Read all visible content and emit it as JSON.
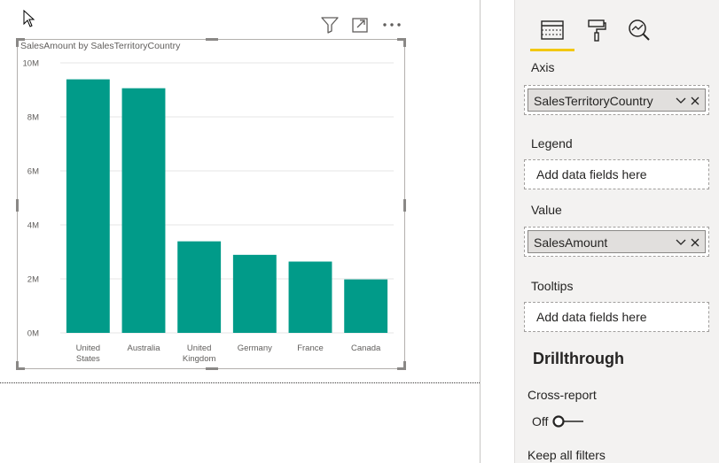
{
  "visual_header": {
    "filter_icon": "filter-icon",
    "focus_icon": "focus-mode-icon",
    "more_icon": "more-options-icon"
  },
  "chart_data": {
    "type": "bar",
    "title": "SalesAmount by SalesTerritoryCountry",
    "categories": [
      "United States",
      "Australia",
      "United Kingdom",
      "Germany",
      "France",
      "Canada"
    ],
    "category_lines": [
      [
        "United",
        "States"
      ],
      [
        "Australia"
      ],
      [
        "United",
        "Kingdom"
      ],
      [
        "Germany"
      ],
      [
        "France"
      ],
      [
        "Canada"
      ]
    ],
    "values": [
      9390000,
      9060000,
      3390000,
      2890000,
      2640000,
      1980000
    ],
    "y_ticks": [
      0,
      2000000,
      4000000,
      6000000,
      8000000,
      10000000
    ],
    "y_tick_labels": [
      "0M",
      "2M",
      "4M",
      "6M",
      "8M",
      "10M"
    ],
    "ylim": [
      0,
      10000000
    ],
    "grid": true,
    "bar_color": "#019b89"
  },
  "pane": {
    "tabs": [
      {
        "name": "fields-icon",
        "active": true
      },
      {
        "name": "format-paint-roller-icon",
        "active": false
      },
      {
        "name": "analytics-magnifier-icon",
        "active": false
      }
    ],
    "accent": "#f2c811",
    "axis": {
      "label": "Axis",
      "field": "SalesTerritoryCountry"
    },
    "legend": {
      "label": "Legend",
      "placeholder": "Add data fields here"
    },
    "value": {
      "label": "Value",
      "field": "SalesAmount"
    },
    "tooltips": {
      "label": "Tooltips",
      "placeholder": "Add data fields here"
    },
    "drillthrough": {
      "title": "Drillthrough",
      "cross_report_label": "Cross-report",
      "cross_report_state": "Off",
      "keep_all_filters_label": "Keep all filters"
    }
  }
}
